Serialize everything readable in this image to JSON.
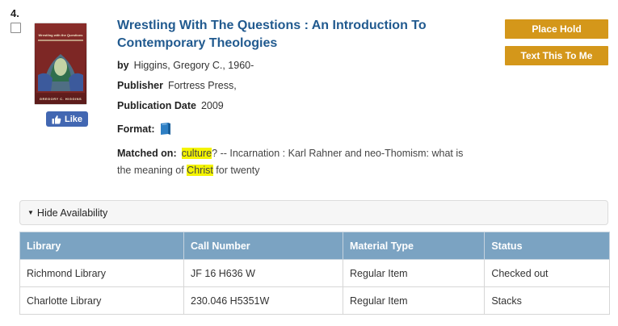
{
  "result": {
    "number": "4.",
    "cover": {
      "title": "Wrestling with the Questions",
      "author": "GREGORY C. HIGGINS"
    },
    "like_label": "Like",
    "title": "Wrestling With The Questions : An Introduction To Contemporary Theologies",
    "by": {
      "label": "by",
      "value": "Higgins, Gregory C., 1960-"
    },
    "publisher": {
      "label": "Publisher",
      "value": "Fortress Press,"
    },
    "publication_date": {
      "label": "Publication Date",
      "value": "2009"
    },
    "format": {
      "label": "Format:",
      "icon": "book-icon"
    },
    "matched_on": {
      "label": "Matched on:",
      "hl1": "culture",
      "t1": "? -- Incarnation : Karl Rahner and neo-Thomism: what is the meaning of ",
      "hl2": "Christ",
      "t2": " for twenty"
    },
    "actions": {
      "place_hold": "Place Hold",
      "text_to_me": "Text This To Me"
    }
  },
  "availability": {
    "toggle_label": "Hide Availability",
    "columns": [
      "Library",
      "Call Number",
      "Material Type",
      "Status"
    ],
    "rows": [
      [
        "Richmond Library",
        "JF 16 H636 W",
        "Regular Item",
        "Checked out"
      ],
      [
        "Charlotte Library",
        "230.046 H5351W",
        "Regular Item",
        "Stacks"
      ]
    ]
  },
  "colors": {
    "title": "#215a8f",
    "button": "#d4971a",
    "table_header": "#7ba3c2",
    "like": "#4267b2",
    "highlight": "#f4f400"
  }
}
